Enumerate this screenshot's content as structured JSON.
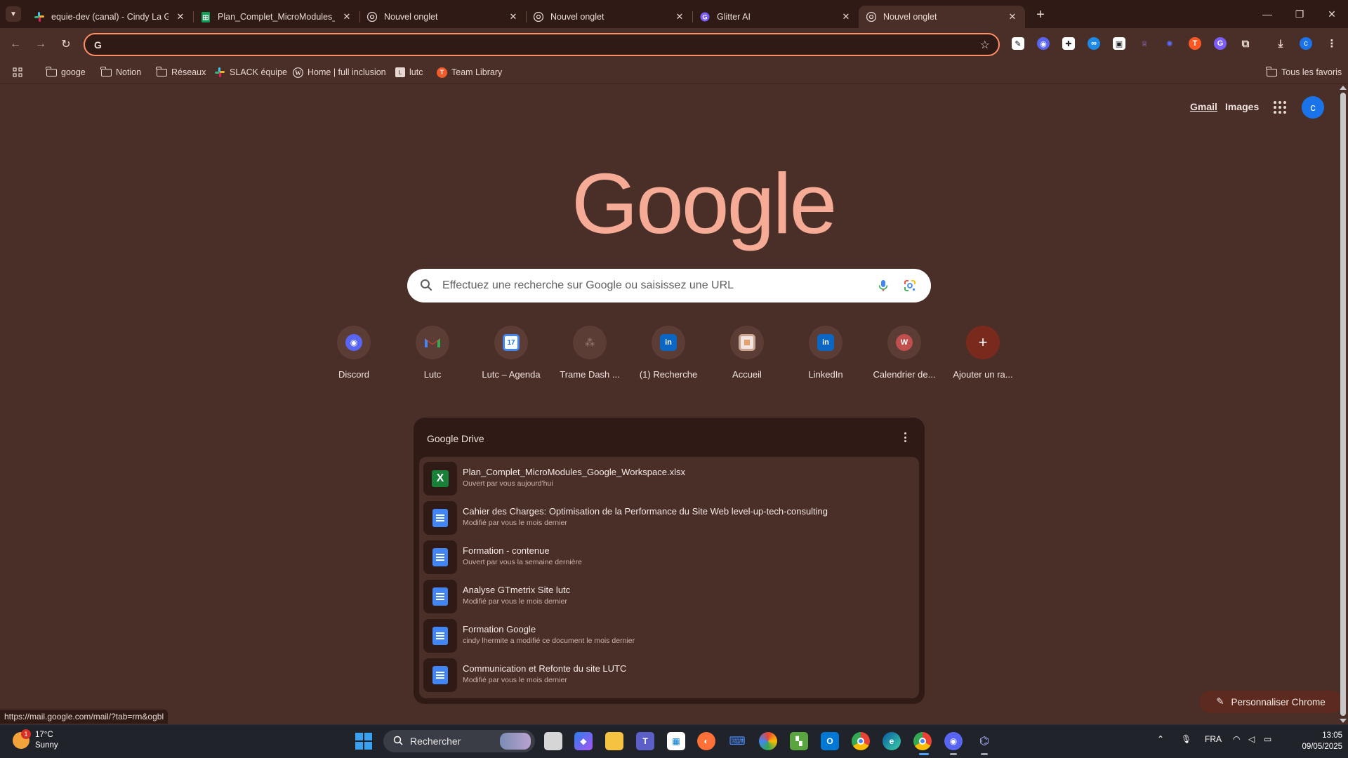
{
  "tabs": [
    {
      "title": "equie-dev (canal) - Cindy La Ge",
      "favicon": "slack-icon",
      "active": false
    },
    {
      "title": "Plan_Complet_MicroModules_G",
      "favicon": "sheets-icon",
      "active": false
    },
    {
      "title": "Nouvel onglet",
      "favicon": "chrome-icon",
      "active": false
    },
    {
      "title": "Nouvel onglet",
      "favicon": "chrome-icon",
      "active": false
    },
    {
      "title": "Glitter AI",
      "favicon": "glitter-icon",
      "active": false
    },
    {
      "title": "Nouvel onglet",
      "favicon": "chrome-icon",
      "active": true
    }
  ],
  "toolbar": {
    "omnibox_value": "",
    "profile_initial": "c"
  },
  "bookmarks": [
    {
      "label": "googe",
      "icon": "folder-icon"
    },
    {
      "label": "Notion",
      "icon": "folder-icon"
    },
    {
      "label": "Réseaux",
      "icon": "folder-icon"
    },
    {
      "label": "SLACK équipe",
      "icon": "slack-icon"
    },
    {
      "label": "Home | full inclusion",
      "icon": "wordpress-icon"
    },
    {
      "label": "lutc",
      "icon": "lutc-icon"
    },
    {
      "label": "Team Library",
      "icon": "team-library-icon"
    }
  ],
  "all_bookmarks": "Tous les favoris",
  "ntp": {
    "gmail": "Gmail",
    "images": "Images",
    "avatar_initial": "c",
    "logo": "Google",
    "search_placeholder": "Effectuez une recherche sur Google ou saisissez une URL"
  },
  "shortcuts": [
    {
      "label": "Discord",
      "icon": "discord-icon"
    },
    {
      "label": "Lutc",
      "icon": "gmail-icon"
    },
    {
      "label": "Lutc – Agenda",
      "icon": "calendar-icon"
    },
    {
      "label": "Trame Dash ...",
      "icon": "people-icon"
    },
    {
      "label": "(1) Recherche",
      "icon": "linkedin-icon"
    },
    {
      "label": "Accueil",
      "icon": "accueil-icon"
    },
    {
      "label": "LinkedIn",
      "icon": "linkedin-icon"
    },
    {
      "label": "Calendrier de...",
      "icon": "w-icon"
    },
    {
      "label": "Ajouter un ra...",
      "icon": "plus-icon"
    }
  ],
  "drive": {
    "title": "Google Drive",
    "files": [
      {
        "name": "Plan_Complet_MicroModules_Google_Workspace.xlsx",
        "sub": "Ouvert par vous aujourd'hui",
        "type": "xls"
      },
      {
        "name": "Cahier des Charges: Optimisation de la Performance du Site Web level-up-tech-consulting",
        "sub": "Modifié par vous le mois dernier",
        "type": "doc"
      },
      {
        "name": "Formation - contenue",
        "sub": "Ouvert par vous la semaine dernière",
        "type": "doc"
      },
      {
        "name": "Analyse GTmetrix Site lutc",
        "sub": "Modifié par vous le mois dernier",
        "type": "doc"
      },
      {
        "name": "Formation Google",
        "sub": "cindy lhermite a modifié ce document le mois dernier",
        "type": "doc"
      },
      {
        "name": "Communication et Refonte du site LUTC",
        "sub": "Modifié par vous le mois dernier",
        "type": "doc"
      }
    ]
  },
  "status_url": "https://mail.google.com/mail/?tab=rm&ogbl",
  "customize_label": "Personnaliser Chrome",
  "taskbar": {
    "weather_temp": "17°C",
    "weather_desc": "Sunny",
    "weather_badge": "1",
    "search_label": "Rechercher",
    "language": "FRA",
    "time": "13:05",
    "date": "09/05/2025"
  }
}
